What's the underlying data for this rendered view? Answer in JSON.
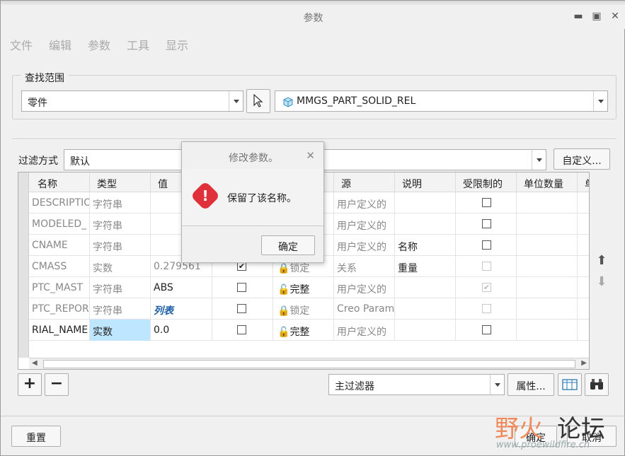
{
  "window": {
    "title": "参数"
  },
  "menu": [
    "文件",
    "编辑",
    "参数",
    "工具",
    "显示"
  ],
  "search_scope": {
    "label": "查找范围",
    "scope_value": "零件",
    "model_value": "MMGS_PART_SOLID_REL"
  },
  "filter": {
    "label": "过滤方式",
    "value": "默认",
    "customize_label": "自定义..."
  },
  "table": {
    "headers": [
      "名称",
      "类型",
      "值",
      "",
      "",
      "源",
      "说明",
      "受限制的",
      "单位数量",
      "单"
    ],
    "rows": [
      {
        "name": "DESCRIPTIO",
        "type": "字符串",
        "value": "",
        "source": "用户定义的",
        "desc": "",
        "restricted": false
      },
      {
        "name": "MODELED_",
        "type": "字符串",
        "value": "",
        "source": "用户定义的",
        "desc": "",
        "restricted": false
      },
      {
        "name": "CNAME",
        "type": "字符串",
        "value": "",
        "source": "用户定义的",
        "desc": "名称",
        "restricted": false
      },
      {
        "name": "CMASS",
        "type": "实数",
        "value": "0.279561",
        "access": "锁定",
        "source": "关系",
        "desc": "重量",
        "restricted": false
      },
      {
        "name": "PTC_MAST",
        "type": "字符串",
        "value": "ABS",
        "access": "完整",
        "source": "用户定义的",
        "desc": "",
        "restricted": true
      },
      {
        "name": "PTC_REPOR",
        "type": "字符串",
        "value": "列表",
        "access": "锁定",
        "source": "Creo Param",
        "desc": "",
        "restricted": false
      },
      {
        "name": "RIAL_NAME",
        "type": "实数",
        "value": "0.0",
        "access": "完整",
        "source": "用户定义的",
        "desc": "",
        "restricted": false
      }
    ]
  },
  "filter_bar": {
    "main_filter": "主过滤器",
    "properties_label": "属性..."
  },
  "dialog": {
    "title": "修改参数。",
    "message": "保留了该名称。",
    "ok_label": "确定"
  },
  "footer": {
    "reset_label": "重置",
    "ok_label": "确定",
    "cancel_label": "取消"
  },
  "watermark": {
    "text1": "野火",
    "text2": "论坛",
    "url": "www.proewildfire.cn"
  },
  "colors": {
    "selected_cell": "#bfe6ff",
    "error_red": "#e0303a",
    "link_blue": "#1f5fa8"
  }
}
